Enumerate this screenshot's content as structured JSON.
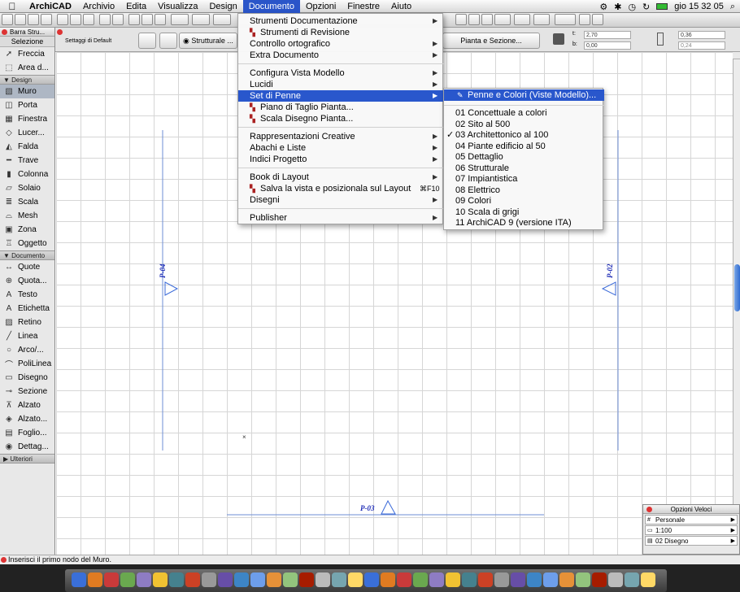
{
  "menubar": {
    "apple": "",
    "items": [
      "ArchiCAD",
      "Archivio",
      "Edita",
      "Visualizza",
      "Design",
      "Documento",
      "Opzioni",
      "Finestre",
      "Aiuto"
    ],
    "active_index": 5,
    "clock": "gio 15 32 05"
  },
  "palette": {
    "title": "Barra Stru...",
    "selection_label": "Selezione",
    "selection_tools": [
      {
        "label": "Freccia",
        "icon": "arrow-icon"
      },
      {
        "label": "Area d...",
        "icon": "marquee-icon"
      }
    ],
    "design_label": "Design",
    "design_tools": [
      {
        "label": "Muro",
        "icon": "wall-icon",
        "selected": true
      },
      {
        "label": "Porta",
        "icon": "door-icon"
      },
      {
        "label": "Finestra",
        "icon": "window-icon"
      },
      {
        "label": "Lucer...",
        "icon": "skylight-icon"
      },
      {
        "label": "Falda",
        "icon": "roof-icon"
      },
      {
        "label": "Trave",
        "icon": "beam-icon"
      },
      {
        "label": "Colonna",
        "icon": "column-icon"
      },
      {
        "label": "Solaio",
        "icon": "slab-icon"
      },
      {
        "label": "Scala",
        "icon": "stair-icon"
      },
      {
        "label": "Mesh",
        "icon": "mesh-icon"
      },
      {
        "label": "Zona",
        "icon": "zone-icon"
      },
      {
        "label": "Oggetto",
        "icon": "object-icon"
      }
    ],
    "document_label": "Documento",
    "document_tools": [
      {
        "label": "Quote",
        "icon": "dimension-icon"
      },
      {
        "label": "Quota...",
        "icon": "level-dimension-icon"
      },
      {
        "label": "Testo",
        "icon": "text-icon"
      },
      {
        "label": "Etichetta",
        "icon": "label-icon"
      },
      {
        "label": "Retino",
        "icon": "fill-icon"
      },
      {
        "label": "Linea",
        "icon": "line-icon"
      },
      {
        "label": "Arco/...",
        "icon": "arc-icon"
      },
      {
        "label": "PoliLinea",
        "icon": "polyline-icon"
      },
      {
        "label": "Disegno",
        "icon": "drawing-icon"
      },
      {
        "label": "Sezione",
        "icon": "section-icon"
      },
      {
        "label": "Alzato",
        "icon": "elevation-icon"
      },
      {
        "label": "Alzato...",
        "icon": "interior-elevation-icon"
      },
      {
        "label": "Foglio...",
        "icon": "worksheet-icon"
      },
      {
        "label": "Dettag...",
        "icon": "detail-icon"
      }
    ],
    "more_label": "Ulteriori"
  },
  "infobox": {
    "default_settings": "Settaggi di Default",
    "structure_label": "Strutturale ...",
    "plan_section_btn": "Pianta e Sezione...",
    "t_label": "t:",
    "t_value": "2,70",
    "b_label": "b:",
    "b_value": "0,00",
    "right_top": "0,36",
    "right_bottom": "0,24"
  },
  "documento_menu": {
    "items": [
      {
        "label": "Strumenti Documentazione",
        "submenu": true
      },
      {
        "label": "Strumenti di Revisione",
        "icon": true
      },
      {
        "label": "Controllo ortografico",
        "submenu": true
      },
      {
        "label": "Extra Documento",
        "submenu": true
      },
      {
        "label": "Configura Vista Modello",
        "submenu": true
      },
      {
        "label": "Lucidi",
        "submenu": true
      },
      {
        "label": "Set di Penne",
        "submenu": true,
        "highlighted": true
      },
      {
        "label": "Piano di Taglio Pianta...",
        "icon": true
      },
      {
        "label": "Scala Disegno Pianta...",
        "icon": true
      },
      {
        "label": "Rappresentazioni Creative",
        "submenu": true
      },
      {
        "label": "Abachi e Liste",
        "submenu": true
      },
      {
        "label": "Indici Progetto",
        "submenu": true
      },
      {
        "label": "Book di Layout",
        "submenu": true
      },
      {
        "label": "Salva la vista e posizionala sul Layout",
        "shortcut": "⌘F10",
        "icon": true
      },
      {
        "label": "Disegni",
        "submenu": true
      },
      {
        "label": "Publisher",
        "submenu": true
      }
    ]
  },
  "pen_submenu": {
    "top_item": "Penne e Colori (Viste Modello)...",
    "items": [
      "01 Concettuale a colori",
      "02 Sito al 500",
      "03 Architettonico al 100",
      "04 Piante edificio al 50",
      "05 Dettaglio",
      "06 Strutturale",
      "07 Impiantistica",
      "08 Elettrico",
      "09 Colori",
      "10 Scala di grigi",
      "11 ArchiCAD 9 (versione ITA)"
    ],
    "checked_index": 2,
    "check_mark": "✓"
  },
  "canvas": {
    "marker_left": "P-04",
    "marker_right": "P-02",
    "marker_bottom": "P-03"
  },
  "quick_options": {
    "title": "Opzioni Veloci",
    "rows": [
      "Personale",
      "1:100",
      "02 Disegno"
    ]
  },
  "status": {
    "text": "Inserisci il primo nodo del Muro."
  },
  "colors": {
    "highlight": "#2957cc",
    "marker_blue": "#1f2db6"
  }
}
